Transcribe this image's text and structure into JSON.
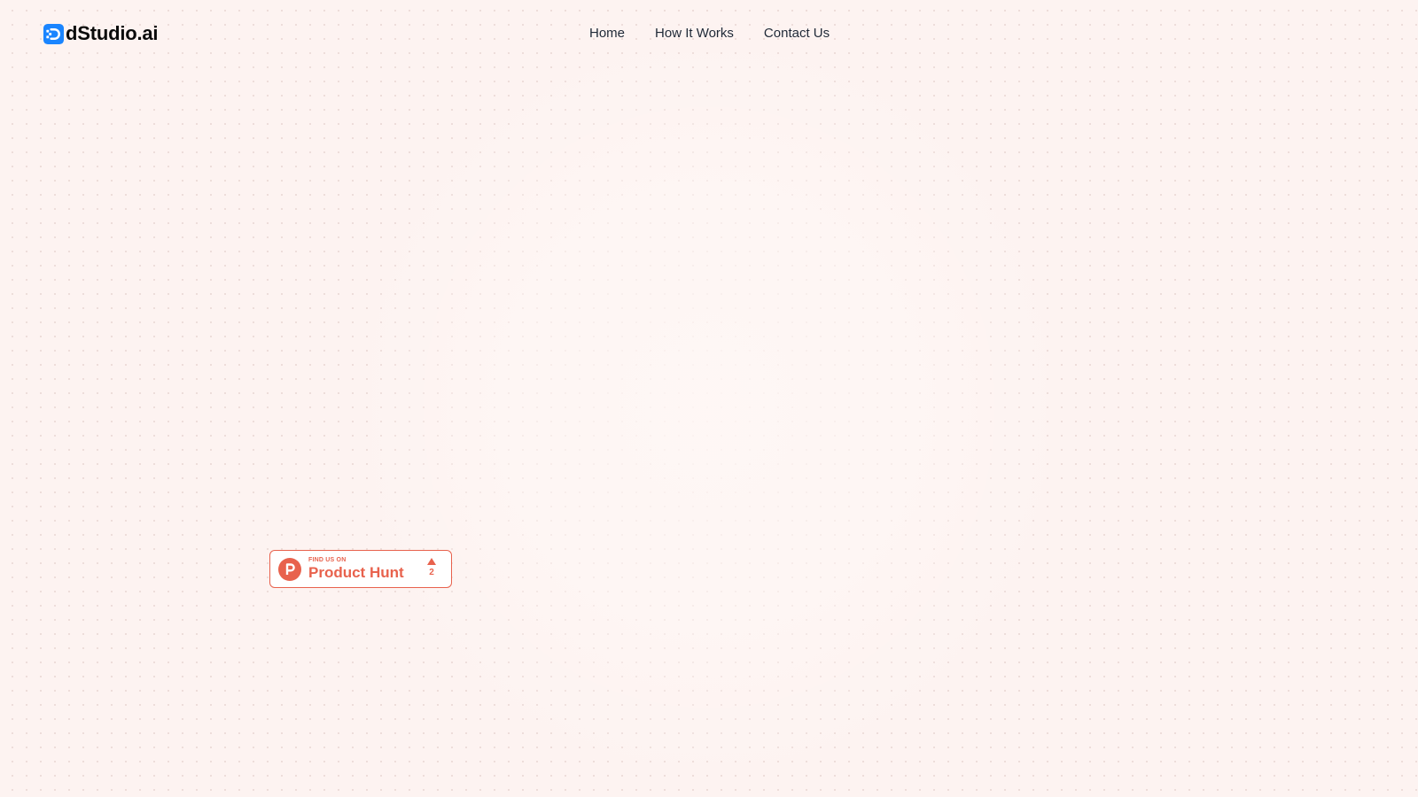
{
  "brand": {
    "name": "dStudio.ai",
    "logo_icon": "dstudio-logo-icon",
    "accent_color": "#1a85ff"
  },
  "nav": {
    "items": [
      {
        "label": "Home"
      },
      {
        "label": "How It Works"
      },
      {
        "label": "Contact Us"
      }
    ]
  },
  "product_hunt": {
    "eyebrow": "FIND US ON",
    "title": "Product Hunt",
    "upvotes": "2",
    "logo_icon": "product-hunt-icon",
    "upvote_icon": "upvote-arrow-icon",
    "color": "#e8624d"
  },
  "colors": {
    "background": "#fdf3f1",
    "text": "#1f2937"
  }
}
